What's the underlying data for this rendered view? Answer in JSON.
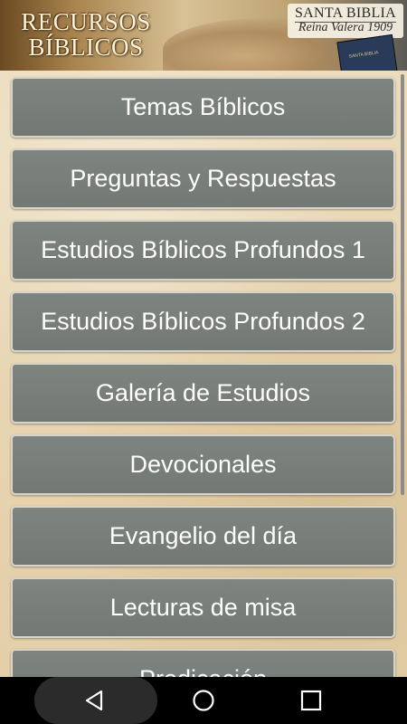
{
  "header": {
    "title_line1": "RECURSOS",
    "title_line2": "BÍBLICOS",
    "bible_title": "SANTA BIBLIA",
    "bible_subtitle": "Reina Valera 1909",
    "book_label": "SANTA BIBLIA"
  },
  "menu": {
    "items": [
      {
        "label": "Temas Bíblicos"
      },
      {
        "label": "Preguntas y Respuestas"
      },
      {
        "label": "Estudios Bíblicos Profundos 1"
      },
      {
        "label": "Estudios Bíblicos Profundos 2"
      },
      {
        "label": "Galería de Estudios"
      },
      {
        "label": "Devocionales"
      },
      {
        "label": "Evangelio del día"
      },
      {
        "label": "Lecturas de misa"
      },
      {
        "label": "Predicación"
      }
    ]
  },
  "navbar": {
    "icons": [
      "back-icon",
      "home-icon",
      "recents-icon"
    ]
  }
}
